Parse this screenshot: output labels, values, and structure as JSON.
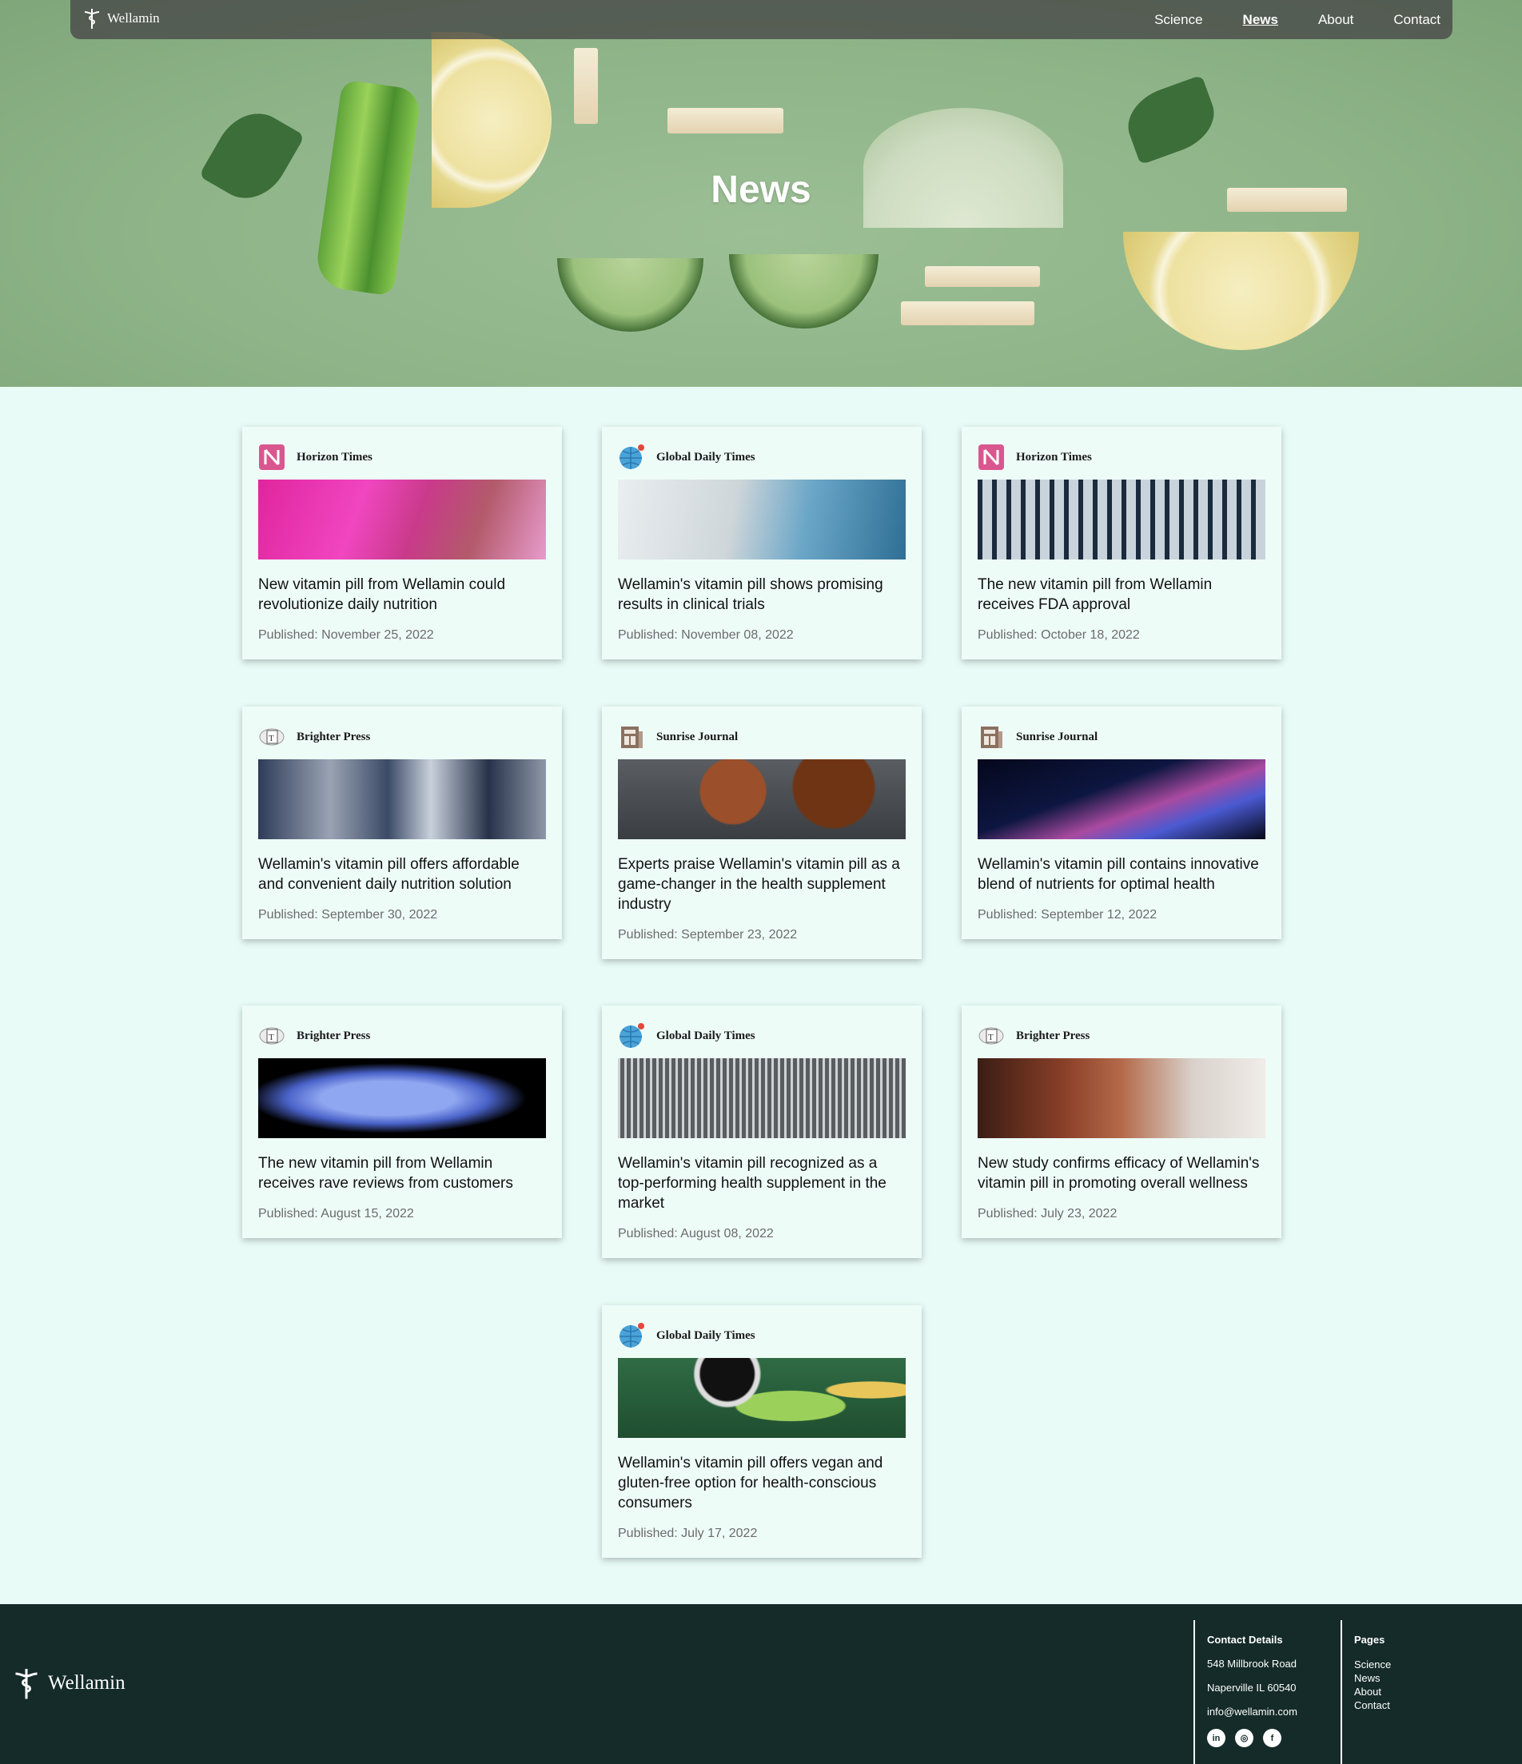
{
  "nav": {
    "brand": "Wellamin",
    "links": [
      {
        "label": "Science",
        "active": false
      },
      {
        "label": "News",
        "active": true
      },
      {
        "label": "About",
        "active": false
      },
      {
        "label": "Contact",
        "active": false
      }
    ]
  },
  "hero": {
    "title": "News"
  },
  "articles": [
    {
      "source": "Horizon Times",
      "source_icon": "horizon-times-logo",
      "title": "New vitamin pill from Wellamin could revolutionize daily nutrition",
      "published": "Published: November 25, 2022",
      "image": "lab-scientist-pink-light"
    },
    {
      "source": "Global Daily Times",
      "source_icon": "global-daily-times-logo",
      "title": "Wellamin's vitamin pill shows promising results in clinical trials",
      "published": "Published: November 08, 2022",
      "image": "gloved-hand-test-tube"
    },
    {
      "source": "Horizon Times",
      "source_icon": "horizon-times-logo",
      "title": "The new vitamin pill from Wellamin receives FDA approval",
      "published": "Published: October 18, 2022",
      "image": "test-tube-tray"
    },
    {
      "source": "Brighter Press",
      "source_icon": "brighter-press-logo",
      "title": "Wellamin's vitamin pill offers affordable and convenient daily nutrition solution",
      "published": "Published: September 30, 2022",
      "image": "microscopes-lab"
    },
    {
      "source": "Sunrise Journal",
      "source_icon": "sunrise-journal-logo",
      "title": "Experts praise Wellamin's vitamin pill as a game-changer in the health supplement industry",
      "published": "Published: September 23, 2022",
      "image": "anatomy-models"
    },
    {
      "source": "Sunrise Journal",
      "source_icon": "sunrise-journal-logo",
      "title": "Wellamin's vitamin pill contains innovative blend of nutrients for optimal health",
      "published": "Published: September 12, 2022",
      "image": "dna-helix"
    },
    {
      "source": "Brighter Press",
      "source_icon": "brighter-press-logo",
      "title": "The new vitamin pill from Wellamin receives rave reviews from customers",
      "published": "Published: August 15, 2022",
      "image": "blue-cell"
    },
    {
      "source": "Global Daily Times",
      "source_icon": "global-daily-times-logo",
      "title": "Wellamin's vitamin pill recognized as a top-performing health supplement in the market",
      "published": "Published: August 08, 2022",
      "image": "pipette-rows"
    },
    {
      "source": "Brighter Press",
      "source_icon": "brighter-press-logo",
      "title": "New study confirms efficacy of Wellamin's vitamin pill in promoting overall wellness",
      "published": "Published: July 23, 2022",
      "image": "scientist-sample"
    },
    {
      "source": "Global Daily Times",
      "source_icon": "global-daily-times-logo",
      "title": "Wellamin's vitamin pill offers vegan and gluten-free option for health-conscious consumers",
      "published": "Published: July 17, 2022",
      "image": "greens-bowl"
    }
  ],
  "footer": {
    "brand": "Wellamin",
    "contact": {
      "heading": "Contact Details",
      "address1": "548 Millbrook Road",
      "address2": "Naperville IL 60540",
      "email": "info@wellamin.com",
      "social": [
        "linkedin-icon",
        "instagram-icon",
        "facebook-icon"
      ]
    },
    "pages": {
      "heading": "Pages",
      "links": [
        "Science",
        "News",
        "About",
        "Contact"
      ]
    }
  },
  "colors": {
    "page_bg": "#e8fbf6",
    "footer_bg": "#142b29",
    "hero_bg": "#8fb489",
    "nav_bg": "#464646"
  }
}
